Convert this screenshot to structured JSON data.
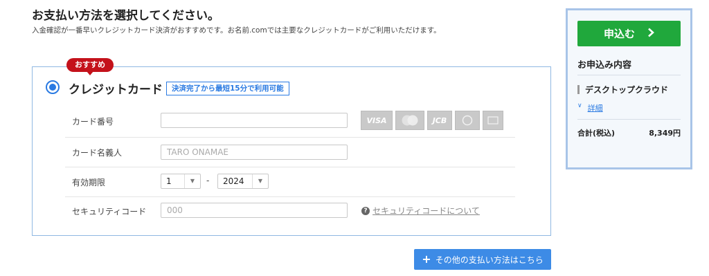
{
  "page": {
    "heading": "お支払い方法を選択してください。",
    "subtext": "入金確認が一番早いクレジットカード決済がおすすめです。お名前.comでは主要なクレジットカードがご利用いただけます。"
  },
  "payment": {
    "badge": "おすすめ",
    "method_title": "クレジットカード",
    "tag": "決済完了から最短15分で利用可能",
    "card_number_label": "カード番号",
    "card_number_value": "",
    "card_name_label": "カード名義人",
    "card_name_placeholder": "TARO ONAMAE",
    "expiry_label": "有効期限",
    "expiry_month": "1",
    "expiry_sep": "-",
    "expiry_year": "2024",
    "security_label": "セキュリティコード",
    "security_placeholder": "000",
    "security_help": "セキュリティコードについて",
    "card_logos": [
      "VISA",
      "Mastercard",
      "JCB",
      "Diners Club",
      "American Express"
    ],
    "visa_text": "VISA",
    "jcb_text": "JCB"
  },
  "other_methods": {
    "label": "その他の支払い方法はこちら"
  },
  "sidebar": {
    "apply_label": "申込む",
    "title": "お申込み内容",
    "product": "デスクトップクラウド",
    "detail_link": "詳細",
    "total_label": "合計(税込)",
    "total_value": "8,349円"
  },
  "colors": {
    "accent": "#2a7ae2",
    "badge": "#c4121b",
    "apply_button": "#20a83c",
    "other_button": "#3d8be6",
    "sidebar_border": "#a8c4e8"
  }
}
